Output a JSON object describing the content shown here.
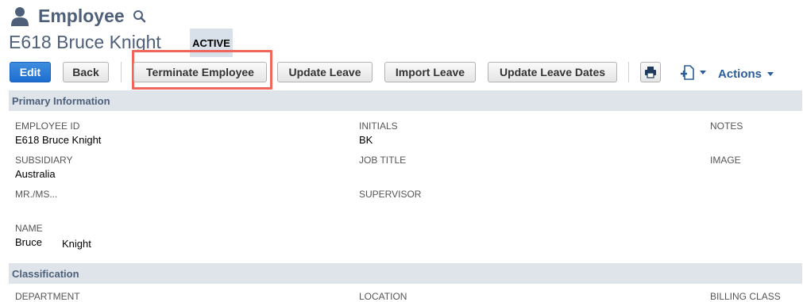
{
  "header": {
    "app_title": "Employee",
    "record_name": "E618 Bruce Knight",
    "status": "ACTIVE"
  },
  "toolbar": {
    "edit": "Edit",
    "back": "Back",
    "terminate": "Terminate Employee",
    "update_leave": "Update Leave",
    "import_leave": "Import Leave",
    "update_leave_dates": "Update Leave Dates",
    "actions": "Actions"
  },
  "icons": {
    "person": "person-icon",
    "search": "search-icon",
    "print": "print-icon",
    "new_document": "new-document-icon"
  },
  "colors": {
    "primary_button": "#1d6ed1",
    "highlight_border": "#f0665a",
    "section_bar": "#dfe4eb",
    "title": "#4d5f79"
  },
  "sections": {
    "primary": "Primary Information",
    "classification": "Classification"
  },
  "fields": {
    "employee_id": {
      "label": "EMPLOYEE ID",
      "value": "E618 Bruce Knight"
    },
    "initials": {
      "label": "INITIALS",
      "value": "BK"
    },
    "notes": {
      "label": "NOTES"
    },
    "subsidiary": {
      "label": "SUBSIDIARY",
      "value": "Australia"
    },
    "job_title": {
      "label": "JOB TITLE"
    },
    "image": {
      "label": "IMAGE"
    },
    "mr_ms": {
      "label": "MR./MS..."
    },
    "supervisor": {
      "label": "SUPERVISOR"
    },
    "name": {
      "label": "NAME",
      "first": "Bruce",
      "last": "Knight"
    }
  },
  "classification_fields": {
    "department": "DEPARTMENT",
    "location": "LOCATION",
    "billing_class": "BILLING CLASS"
  }
}
